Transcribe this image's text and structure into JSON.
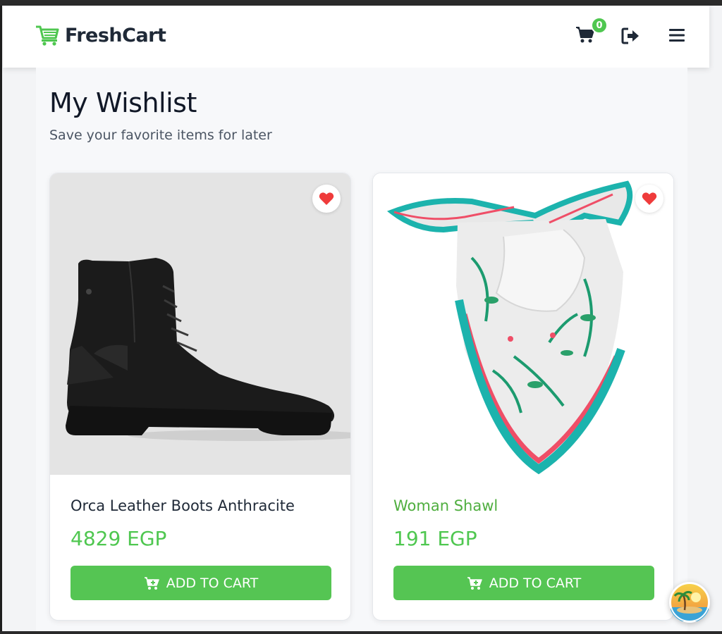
{
  "brand": {
    "name": "FreshCart",
    "icon": "cart-logo-icon"
  },
  "nav": {
    "cart_count": "0",
    "cart_icon": "shopping-cart-icon",
    "logout_icon": "logout-icon",
    "menu_icon": "hamburger-menu-icon"
  },
  "page": {
    "title": "My Wishlist",
    "subtitle": "Save your favorite items for later"
  },
  "products": [
    {
      "title": "Orca Leather Boots Anthracite",
      "price": "4829 EGP",
      "button_label": "ADD TO CART",
      "image": "black-leather-boot"
    },
    {
      "title": "Woman Shawl",
      "price": "191 EGP",
      "button_label": "ADD TO CART",
      "image": "floral-silk-shawl"
    }
  ],
  "colors": {
    "accent": "#4fc750",
    "heart": "#ef3b3b",
    "text_dark": "#1f2937"
  }
}
